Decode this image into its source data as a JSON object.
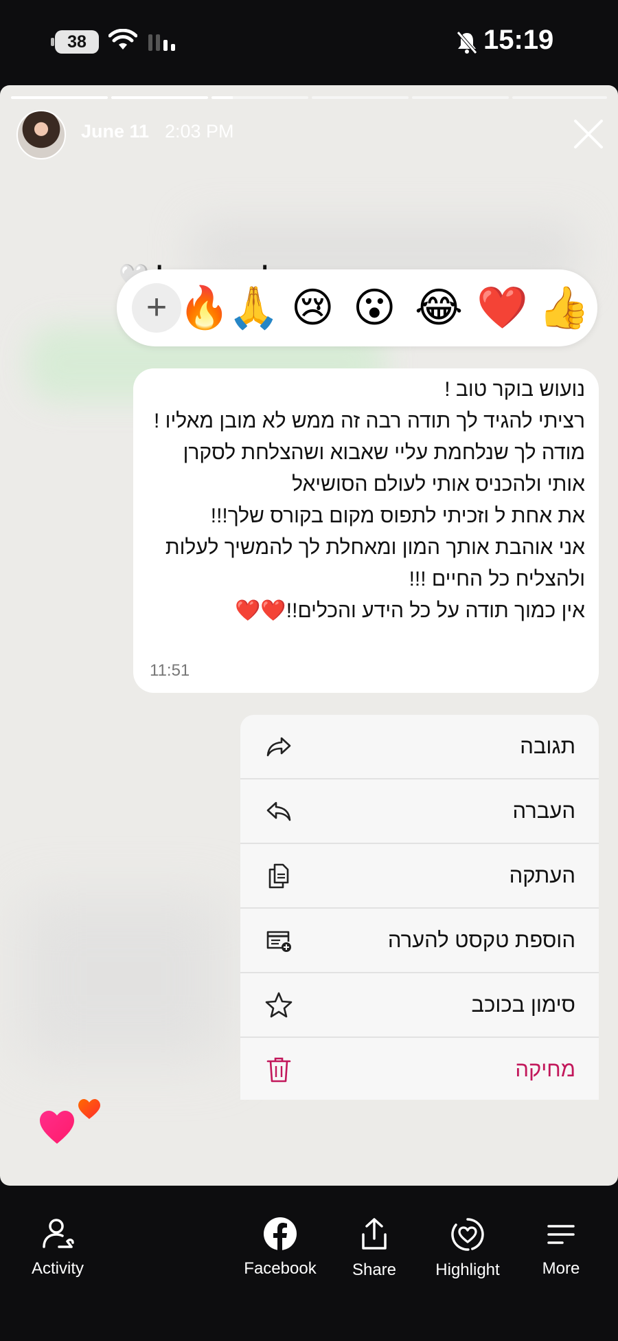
{
  "status_bar": {
    "battery": "38",
    "time": "15:19"
  },
  "story": {
    "date": "June 11",
    "posted_time": "2:03 PM",
    "caption": "זכיתי בתלמידות שלי",
    "caption_emoji": "🤍"
  },
  "reactions": {
    "emojis": [
      "👍",
      "❤️",
      "😂",
      "😮",
      "😢",
      "🙏",
      "🔥"
    ],
    "plus": "+"
  },
  "message": {
    "text": "נועוש בוקר טוב !\nרציתי להגיד לך תודה רבה זה ממש לא מובן מאליו !\nמודה לך שנלחמת עליי שאבוא ושהצלחת לסקרן אותי ולהכניס אותי לעולם הסושיאל\nאת אחת ל וזכיתי לתפוס מקום בקורס שלך!!!\nאני אוהבת אותך המון ומאחלת לך להמשיך לעלות ולהצליח כל החיים !!!\nאין כמוך תודה על כל הידע והכלים!!❤️❤️",
    "time": "11:51"
  },
  "context_menu": {
    "items": [
      {
        "label": "תגובה",
        "icon": "forward-arrow-icon"
      },
      {
        "label": "העברה",
        "icon": "reply-arrow-icon"
      },
      {
        "label": "העתקה",
        "icon": "copy-icon"
      },
      {
        "label": "הוספת טקסט להערה",
        "icon": "add-note-icon"
      },
      {
        "label": "סימון בכוכב",
        "icon": "star-icon"
      },
      {
        "label": "מחיקה",
        "icon": "trash-icon",
        "color": "#c2185b"
      }
    ]
  },
  "bottom_nav": {
    "activity": "Activity",
    "facebook": "Facebook",
    "share": "Share",
    "highlight": "Highlight",
    "more": "More"
  }
}
